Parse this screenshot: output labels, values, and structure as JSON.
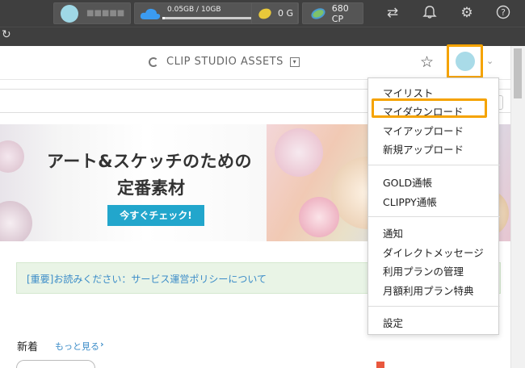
{
  "topbar": {
    "storage_text": "0.05GB / 10GB",
    "storage_fraction": 0.005,
    "gold": "0 G",
    "cp": "680 CP"
  },
  "header": {
    "logo_text": "CLIP STUDIO ASSETS"
  },
  "banner": {
    "title_line1": "アート&スケッチのための",
    "title_line2": "定番素材",
    "cta": "今すぐチェック!"
  },
  "notice": {
    "text": "[重要]お読みください：サービス運営ポリシーについて"
  },
  "new_section": {
    "title": "新着",
    "more": "もっと見る"
  },
  "menu": {
    "group1": [
      "マイリスト",
      "マイダウンロード",
      "マイアップロード",
      "新規アップロード"
    ],
    "group2": [
      "GOLD通帳",
      "CLIPPY通帳"
    ],
    "group3": [
      "通知",
      "ダイレクトメッセージ",
      "利用プランの管理",
      "月額利用プラン特典"
    ],
    "group4": [
      "設定"
    ]
  },
  "colors": {
    "highlight": "#f5a300",
    "accent": "#22a6cc",
    "link": "#3b8cc8"
  }
}
